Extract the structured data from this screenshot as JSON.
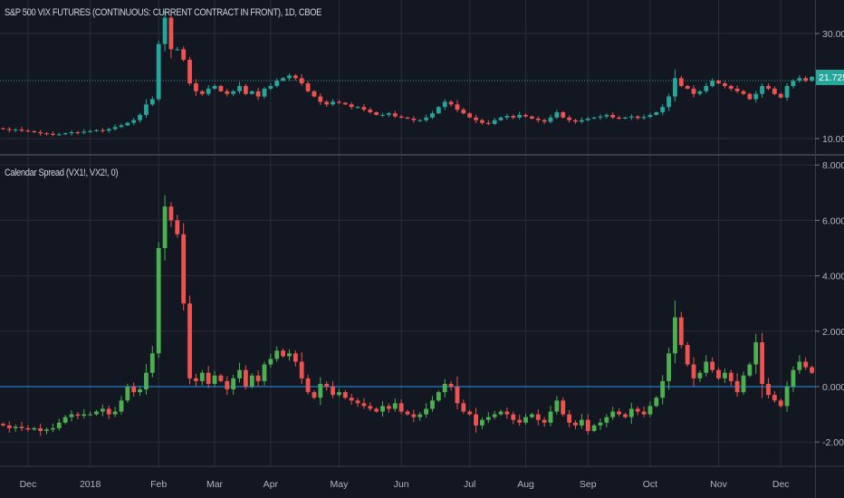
{
  "chart_data": [
    {
      "type": "candlestick",
      "title": "S&P 500 VIX FUTURES (CONTINUOUS: CURRENT CONTRACT IN FRONT), 1D, CBOE",
      "ylim": [
        5,
        36
      ],
      "yticks": [
        "30.000",
        "10.000"
      ],
      "ytick_values": [
        30,
        10
      ],
      "last_price_label": "21.725",
      "last_price": 21.725,
      "colors": {
        "up": "#26a69a",
        "down": "#ef5350",
        "last_line": "#26a69a"
      },
      "closes": [
        11.8,
        11.6,
        11.7,
        11.5,
        11.4,
        11.2,
        11.0,
        10.9,
        10.7,
        10.8,
        11.0,
        11.2,
        11.1,
        11.3,
        11.4,
        11.6,
        11.5,
        11.8,
        12.2,
        12.5,
        13.0,
        13.5,
        14.5,
        16.5,
        17.5,
        28,
        33,
        27,
        27,
        25,
        20.5,
        19,
        18.5,
        19.5,
        20,
        19,
        18.5,
        19,
        20,
        18.5,
        19,
        18,
        19.5,
        20,
        21,
        21.5,
        22,
        21.5,
        20.5,
        19,
        18,
        17,
        16.5,
        17,
        16.8,
        16.5,
        16,
        16,
        15.5,
        15,
        14.5,
        14.5,
        14.8,
        14.2,
        14,
        13.8,
        13.5,
        13.5,
        14,
        14.8,
        16,
        17,
        16.5,
        15.5,
        14.8,
        14,
        13.5,
        13,
        12.8,
        13.5,
        14,
        14.3,
        14,
        14.5,
        14.2,
        13.8,
        13.5,
        13.2,
        14,
        15,
        14,
        13.5,
        13.2,
        13.5,
        13.8,
        14,
        14.2,
        14.5,
        14,
        13.8,
        14,
        14.2,
        13.9,
        14.1,
        14.5,
        15,
        16,
        18,
        21.5,
        20,
        19.5,
        18.5,
        19,
        20,
        21,
        20.5,
        20,
        19.5,
        19,
        18.5,
        17.5,
        18.5,
        20,
        19.5,
        18.5,
        17.8,
        20,
        21,
        21.5,
        21,
        21.725
      ]
    },
    {
      "type": "candlestick",
      "title": "Calendar Spread (VX1!, VX2!, 0)",
      "ylim": [
        -2.9,
        8.2
      ],
      "yticks": [
        "8.000",
        "6.000",
        "4.000",
        "2.000",
        "0.000",
        "-2.000"
      ],
      "ytick_values": [
        8,
        6,
        4,
        2,
        0,
        -2
      ],
      "zero_line": 0,
      "colors": {
        "up": "#4caf50",
        "down": "#ef5350",
        "zero_line": "#2196f3"
      },
      "closes": [
        -1.4,
        -1.5,
        -1.45,
        -1.5,
        -1.55,
        -1.5,
        -1.6,
        -1.55,
        -1.5,
        -1.3,
        -1.1,
        -1.0,
        -1.05,
        -1.0,
        -1.0,
        -0.9,
        -0.8,
        -1.0,
        -0.9,
        -0.5,
        0.0,
        -0.2,
        -0.1,
        0.5,
        1.2,
        5.0,
        6.5,
        6.0,
        5.5,
        3.0,
        0.3,
        0.2,
        0.5,
        0.1,
        0.4,
        0.2,
        -0.1,
        0.3,
        0.6,
        0.0,
        0.4,
        0.2,
        0.8,
        1.0,
        1.3,
        1.1,
        1.2,
        0.9,
        0.3,
        -0.2,
        -0.4,
        0.1,
        0.0,
        -0.3,
        -0.2,
        -0.4,
        -0.5,
        -0.6,
        -0.7,
        -0.8,
        -0.9,
        -0.7,
        -0.8,
        -0.6,
        -0.9,
        -1.0,
        -1.1,
        -1.0,
        -0.8,
        -0.5,
        -0.2,
        0.1,
        0.0,
        -0.6,
        -0.9,
        -1.0,
        -1.4,
        -1.2,
        -1.1,
        -1.0,
        -0.9,
        -1.0,
        -1.2,
        -1.3,
        -1.1,
        -1.0,
        -1.2,
        -1.3,
        -0.9,
        -0.5,
        -1.0,
        -1.3,
        -1.4,
        -1.2,
        -1.6,
        -1.4,
        -1.3,
        -1.1,
        -0.9,
        -1.0,
        -1.1,
        -0.8,
        -0.9,
        -1.0,
        -0.7,
        -0.4,
        0.2,
        1.2,
        2.5,
        1.5,
        0.8,
        0.3,
        0.5,
        0.9,
        0.6,
        0.3,
        0.5,
        0.2,
        -0.2,
        0.4,
        0.8,
        1.6,
        0.1,
        -0.3,
        -0.5,
        -0.7,
        0.0,
        0.6,
        0.9,
        0.7,
        0.5
      ]
    }
  ],
  "x_axis": {
    "labels": [
      "Dec",
      "2018",
      "Feb",
      "Mar",
      "Apr",
      "May",
      "Jun",
      "Jul",
      "Aug",
      "Sep",
      "Oct",
      "Nov",
      "Dec"
    ],
    "label_bar_index": [
      4,
      14,
      25,
      34,
      43,
      54,
      64,
      75,
      84,
      94,
      104,
      115,
      125
    ]
  },
  "colors": {
    "background": "#131722",
    "grid": "#2a2e39",
    "text": "#b2b5be"
  }
}
